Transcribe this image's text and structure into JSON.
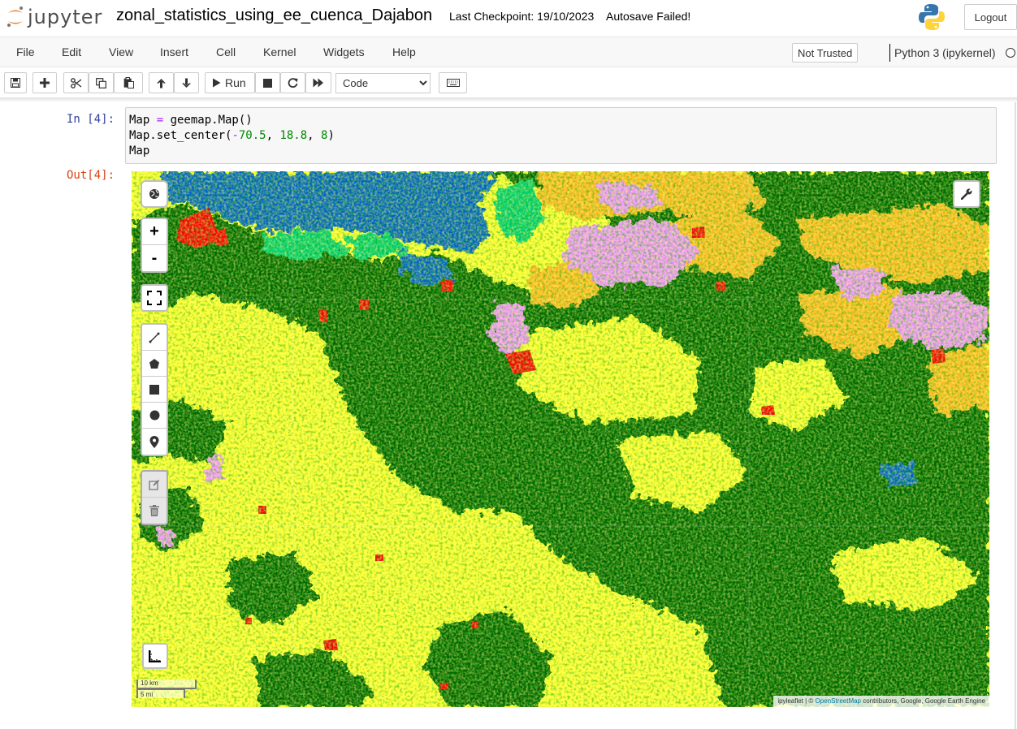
{
  "header": {
    "logo_text": "jupyter",
    "notebook_name": "zonal_statistics_using_ee_cuenca_Dajabon",
    "checkpoint": "Last Checkpoint: 19/10/2023",
    "autosave": "Autosave Failed!",
    "logout_label": "Logout"
  },
  "menubar": {
    "items": [
      "File",
      "Edit",
      "View",
      "Insert",
      "Cell",
      "Kernel",
      "Widgets",
      "Help"
    ],
    "trust_label": "Not Trusted",
    "kernel_name": "Python 3 (ipykernel)"
  },
  "toolbar": {
    "run_label": "Run",
    "cell_type_selected": "Code",
    "buttons": [
      "save-icon",
      "plus-icon",
      "cut-icon",
      "copy-icon",
      "paste-icon",
      "arrow-up-icon",
      "arrow-down-icon",
      "play-icon",
      "stop-icon",
      "restart-icon",
      "fast-forward-icon",
      "keyboard-icon"
    ]
  },
  "cell": {
    "in_prompt": "In [4]:",
    "out_prompt": "Out[4]:",
    "code_lines": [
      [
        "Map ",
        "= ",
        "geemap.Map()"
      ],
      [
        "Map.set_center(",
        "-",
        "70.5",
        ", ",
        "18.8",
        ", ",
        "8",
        ")"
      ],
      [
        "Map"
      ]
    ]
  },
  "map": {
    "scale_km": "10 km",
    "scale_mi": "5 mi",
    "attribution_prefix": "ipyleaflet | © ",
    "attribution_link": "OpenStreetMap",
    "attribution_suffix": " contributors, Google, Google Earth Engine",
    "zoom_in_label": "+",
    "zoom_out_label": "-",
    "colors": {
      "cropland": "#ffff33",
      "trees": "#006400",
      "water": "#0064c8",
      "builtup": "#fa0000",
      "wetland": "#f096ff",
      "shrubland": "#ffbb22",
      "mangrove": "#00cf75"
    }
  }
}
